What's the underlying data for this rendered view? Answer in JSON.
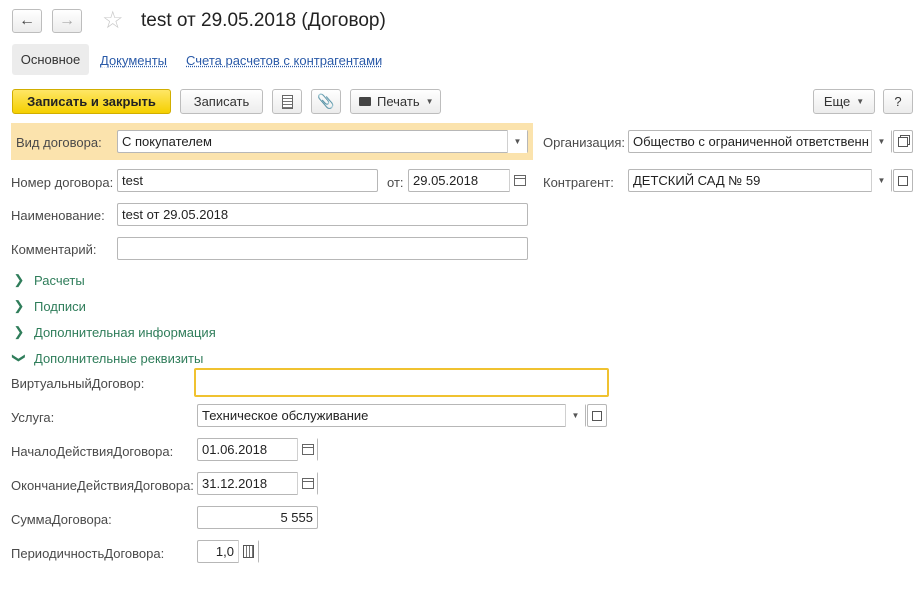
{
  "window": {
    "title": "test от 29.05.2018 (Договор)"
  },
  "tabs": [
    {
      "label": "Основное"
    },
    {
      "label": "Документы"
    },
    {
      "label": "Счета расчетов с контрагентами"
    }
  ],
  "toolbar": {
    "save_close": "Записать и закрыть",
    "save": "Записать",
    "print": "Печать",
    "more": "Еще",
    "help": "?"
  },
  "form": {
    "contract_type_label": "Вид договора:",
    "contract_type_value": "С покупателем",
    "org_label": "Организация:",
    "org_value": "Общество с ограниченной ответственн",
    "number_label": "Номер договора:",
    "number_value": "test",
    "from_label": "от:",
    "date_value": "29.05.2018",
    "counterparty_label": "Контрагент:",
    "counterparty_value": "ДЕТСКИЙ САД № 59",
    "name_label": "Наименование:",
    "name_value": "test от 29.05.2018",
    "comment_label": "Комментарий:",
    "comment_value": ""
  },
  "sections": {
    "payments": "Расчеты",
    "signatures": "Подписи",
    "additional_info": "Дополнительная информация",
    "additional_props": "Дополнительные реквизиты"
  },
  "props": {
    "virtual_label": "ВиртуальныйДоговор:",
    "virtual_value": "",
    "service_label": "Услуга:",
    "service_value": "Техническое обслуживание",
    "start_label": "НачалоДействияДоговора:",
    "start_value": "01.06.2018",
    "end_label": "ОкончаниеДействияДоговора:",
    "end_value": "31.12.2018",
    "sum_label": "СуммаДоговора:",
    "sum_value": "5 555",
    "period_label": "ПериодичностьДоговора:",
    "period_value": "1,0"
  }
}
